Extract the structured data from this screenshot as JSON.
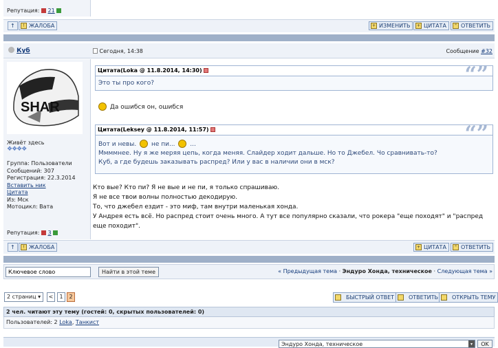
{
  "top": {
    "rep_label": "Репутация:",
    "rep_value": "21"
  },
  "post1_buttons": {
    "up": "↑",
    "complaint": "ЖАЛОБА",
    "edit": "ИЗМЕНИТЬ",
    "quote": "ЦИТАТА",
    "reply": "ОТВЕТИТЬ"
  },
  "post2": {
    "author": "Куб",
    "date": "Сегодня, 14:38",
    "post_label": "Сообщение",
    "post_number": "#32",
    "avatar_text": "SHAR",
    "rank": "Живёт здесь",
    "info": {
      "group": "Группа: Пользователи",
      "messages": "Сообщений: 307",
      "registered": "Регистрация: 22.3.2014",
      "insert_nick": "Вставить ник",
      "quote_link": "Цитата",
      "from": "Из: Мск",
      "bike": "Мотоцикл: Вата"
    },
    "rep_label": "Репутация:",
    "rep_value": "3",
    "quote1": {
      "header": "Цитата(Loka @ 11.8.2014, 14:30)",
      "text": "Это ты про кого?"
    },
    "reply1": "Да ошибся он, ошибся",
    "quote2": {
      "header": "Цитата(Leksey @ 11.8.2014, 11:57)",
      "line1a": "Вот и невы.",
      "line1b": "не пи...",
      "line1c": "...",
      "line2": "Ммммнее. Ну я же меряя цепь, когда меняя. Слайдер ходит дальше. Но то Джебел. Чо сравнивать-то?",
      "line3": "Куб, а где будешь заказывать распред? Или у вас в наличии они в мск?"
    },
    "body": [
      "Кто вые? Кто пи? Я не вые и не пи, я только спрашиваю.",
      "Я не все твои волны полностью декодирую.",
      "То, что джебел ездит - это миф, там внутри маленькая хонда.",
      "У Андрея есть всё. Но распред стоит очень много. А тут все популярно сказали, что рокера \"еще походят\" и \"распред",
      "еще походит\"."
    ],
    "buttons": {
      "up": "↑",
      "complaint": "ЖАЛОБА",
      "quote": "ЦИТАТА",
      "reply": "ОТВЕТИТЬ"
    }
  },
  "search": {
    "placeholder": "Ключевое слово",
    "value": "Ключевое слово",
    "button": "Найти в этой теме",
    "prev": "« Предыдущая тема",
    "sep": "·",
    "topic": "Эндуро Хонда, техническое",
    "next": "Следующая тема »"
  },
  "pagination": {
    "pages_label": "2 страниц",
    "prev": "<",
    "p1": "1",
    "p2": "2"
  },
  "actions": {
    "quick_reply": "БЫСТРЫЙ ОТВЕТ",
    "reply": "ОТВЕТИТЬ",
    "new_topic": "ОТКРЫТЬ ТЕМУ"
  },
  "readers": {
    "header": "2 чел. читают эту тему (гостей: 0, скрытых пользователей: 0)",
    "users_label": "Пользователей: 2",
    "user1": "Loka",
    "user2": "Танкист"
  },
  "footer": {
    "forum_select": "Эндуро Хонда, техническое",
    "ok": "OK"
  }
}
